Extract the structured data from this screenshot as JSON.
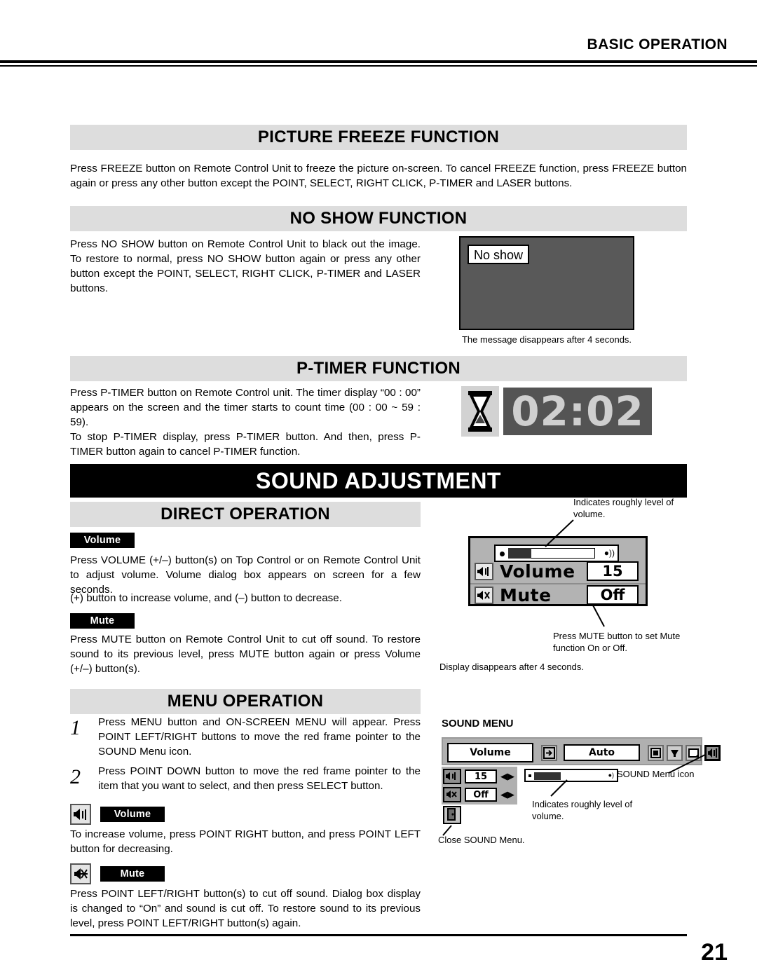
{
  "header": {
    "title": "BASIC OPERATION"
  },
  "sections": {
    "picture_freeze": {
      "heading": "PICTURE FREEZE FUNCTION",
      "body": "Press FREEZE button on Remote Control Unit to freeze the picture on-screen. To cancel FREEZE function, press FREEZE button again or press any other button except the POINT, SELECT, RIGHT CLICK, P-TIMER and LASER buttons."
    },
    "no_show": {
      "heading": "NO SHOW FUNCTION",
      "body": "Press NO SHOW button on Remote Control Unit to black out the image. To restore to normal, press NO SHOW button again or press any other button except the POINT, SELECT, RIGHT CLICK, P-TIMER and LASER buttons.",
      "screen_message": "No show",
      "caption": "The message disappears after 4 seconds."
    },
    "p_timer": {
      "heading": "P-TIMER FUNCTION",
      "body_1": "Press P-TIMER button on Remote Control unit.  The timer display “00 : 00” appears on the screen and the timer starts to count time (00 : 00 ~ 59 : 59).",
      "body_2": "To stop P-TIMER display, press P-TIMER button.  And then, press P-TIMER button again to cancel P-TIMER function.",
      "timer_value": "02:02",
      "hourglass_icon": "hourglass-icon"
    },
    "sound_adjustment": {
      "banner": "SOUND ADJUSTMENT"
    },
    "direct_operation": {
      "heading": "DIRECT OPERATION",
      "volume_tag": "Volume",
      "volume_body_1": "Press VOLUME (+/–) button(s) on Top Control or on Remote Control Unit to adjust volume.  Volume dialog box appears on screen for a few seconds.",
      "volume_body_2": "(+) button to increase volume, and (–) button to decrease.",
      "mute_tag": "Mute",
      "mute_body": "Press MUTE button on Remote Control Unit to cut off sound.  To restore sound to its previous level, press MUTE button again or press Volume (+/–) button(s)."
    },
    "menu_operation": {
      "heading": "MENU OPERATION",
      "steps": [
        {
          "num": "1",
          "text": "Press MENU button and ON-SCREEN MENU will appear.  Press POINT LEFT/RIGHT buttons to move the red frame pointer to the SOUND Menu icon."
        },
        {
          "num": "2",
          "text": "Press POINT DOWN button to move the red frame pointer to the item that you want to select, and then press SELECT button."
        }
      ],
      "volume_tag": "Volume",
      "volume_body": "To increase volume, press POINT RIGHT button, and press POINT LEFT button for decreasing.",
      "mute_tag": "Mute",
      "mute_body": "Press POINT LEFT/RIGHT button(s) to cut off sound.  Dialog box display is changed to “On” and sound is cut off.  To restore sound to its previous level, press POINT LEFT/RIGHT button(s) again."
    }
  },
  "volume_dialog": {
    "annotation_top": "Indicates roughly level of volume.",
    "annotation_bottom": "Press MUTE button to set Mute function On or Off.",
    "caption": "Display disappears after 4 seconds.",
    "volume_label": "Volume",
    "volume_value": "15",
    "mute_label": "Mute",
    "mute_value": "Off",
    "volume_icon": "speaker-volume-icon",
    "mute_icon": "speaker-mute-icon"
  },
  "sound_menu": {
    "title": "SOUND MENU",
    "menu_title": "Volume",
    "auto_label": "Auto",
    "volume_value": "15",
    "mute_value": "Off",
    "annotation_icon": "SOUND Menu icon",
    "annotation_level": "Indicates roughly level of volume.",
    "annotation_close": "Close SOUND Menu.",
    "toolbar_icons": [
      "input-source-icon",
      "screen-icon",
      "color-adjust-icon",
      "image-icon",
      "sound-menu-icon"
    ],
    "panel_icons": [
      "volume-icon",
      "mute-icon",
      "quit-icon"
    ]
  },
  "footer": {
    "page_number": "21"
  },
  "colors": {
    "bar_gray": "#dddddd",
    "banner_black": "#000000",
    "screen_gray": "#595959",
    "osd_gray": "#b3b3b3"
  }
}
